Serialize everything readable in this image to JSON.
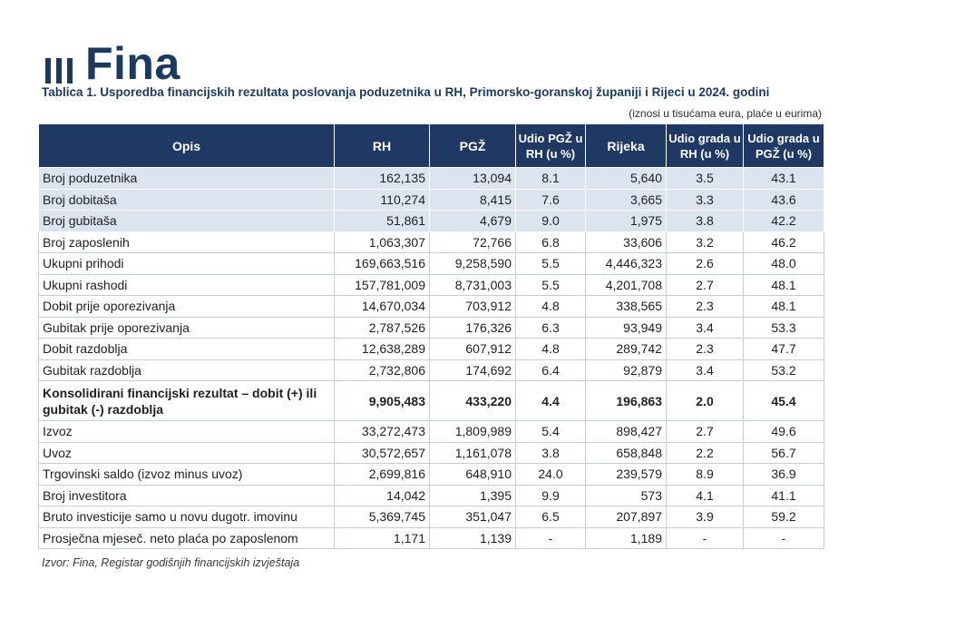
{
  "logo": {
    "text": "Fina"
  },
  "title": "Tablica 1. Usporedba financijskih rezultata poslovanja poduzetnika u RH, Primorsko-goranskoj županiji i Rijeci u 2024. godini",
  "note": "(iznosi u tisućama eura, plaće u eurima)",
  "headers": [
    "Opis",
    "RH",
    "PGŽ",
    "Udio PGŽ u RH (u %)",
    "Rijeka",
    "Udio grada u RH (u %)",
    "Udio grada u PGŽ (u %)"
  ],
  "rows": [
    {
      "opis": "Broj poduzetnika",
      "rh": "162,135",
      "pgz": "13,094",
      "udio_pgz_rh": "8.1",
      "rijeka": "5,640",
      "udio_grada_rh": "3.5",
      "udio_grada_pgz": "43.1",
      "highlight": true
    },
    {
      "opis": "Broj dobitaša",
      "rh": "110,274",
      "pgz": "8,415",
      "udio_pgz_rh": "7.6",
      "rijeka": "3,665",
      "udio_grada_rh": "3.3",
      "udio_grada_pgz": "43.6",
      "highlight": true
    },
    {
      "opis": "Broj gubitaša",
      "rh": "51,861",
      "pgz": "4,679",
      "udio_pgz_rh": "9.0",
      "rijeka": "1,975",
      "udio_grada_rh": "3.8",
      "udio_grada_pgz": "42.2",
      "highlight": true
    },
    {
      "opis": "Broj zaposlenih",
      "rh": "1,063,307",
      "pgz": "72,766",
      "udio_pgz_rh": "6.8",
      "rijeka": "33,606",
      "udio_grada_rh": "3.2",
      "udio_grada_pgz": "46.2"
    },
    {
      "opis": "Ukupni prihodi",
      "rh": "169,663,516",
      "pgz": "9,258,590",
      "udio_pgz_rh": "5.5",
      "rijeka": "4,446,323",
      "udio_grada_rh": "2.6",
      "udio_grada_pgz": "48.0"
    },
    {
      "opis": "Ukupni rashodi",
      "rh": "157,781,009",
      "pgz": "8,731,003",
      "udio_pgz_rh": "5.5",
      "rijeka": "4,201,708",
      "udio_grada_rh": "2.7",
      "udio_grada_pgz": "48.1"
    },
    {
      "opis": "Dobit prije oporezivanja",
      "rh": "14,670,034",
      "pgz": "703,912",
      "udio_pgz_rh": "4.8",
      "rijeka": "338,565",
      "udio_grada_rh": "2.3",
      "udio_grada_pgz": "48.1"
    },
    {
      "opis": "Gubitak prije oporezivanja",
      "rh": "2,787,526",
      "pgz": "176,326",
      "udio_pgz_rh": "6.3",
      "rijeka": "93,949",
      "udio_grada_rh": "3.4",
      "udio_grada_pgz": "53.3"
    },
    {
      "opis": "Dobit razdoblja",
      "rh": "12,638,289",
      "pgz": "607,912",
      "udio_pgz_rh": "4.8",
      "rijeka": "289,742",
      "udio_grada_rh": "2.3",
      "udio_grada_pgz": "47.7"
    },
    {
      "opis": "Gubitak razdoblja",
      "rh": "2,732,806",
      "pgz": "174,692",
      "udio_pgz_rh": "6.4",
      "rijeka": "92,879",
      "udio_grada_rh": "3.4",
      "udio_grada_pgz": "53.2"
    },
    {
      "opis": "Konsolidirani financijski rezultat – dobit (+) ili gubitak (-) razdoblja",
      "rh": "9,905,483",
      "pgz": "433,220",
      "udio_pgz_rh": "4.4",
      "rijeka": "196,863",
      "udio_grada_rh": "2.0",
      "udio_grada_pgz": "45.4",
      "bold": true
    },
    {
      "opis": "Izvoz",
      "rh": "33,272,473",
      "pgz": "1,809,989",
      "udio_pgz_rh": "5.4",
      "rijeka": "898,427",
      "udio_grada_rh": "2.7",
      "udio_grada_pgz": "49.6"
    },
    {
      "opis": "Uvoz",
      "rh": "30,572,657",
      "pgz": "1,161,078",
      "udio_pgz_rh": "3.8",
      "rijeka": "658,848",
      "udio_grada_rh": "2.2",
      "udio_grada_pgz": "56.7"
    },
    {
      "opis": "Trgovinski saldo (izvoz minus uvoz)",
      "rh": "2,699,816",
      "pgz": "648,910",
      "udio_pgz_rh": "24.0",
      "rijeka": "239,579",
      "udio_grada_rh": "8.9",
      "udio_grada_pgz": "36.9"
    },
    {
      "opis": "Broj investitora",
      "rh": "14,042",
      "pgz": "1,395",
      "udio_pgz_rh": "9.9",
      "rijeka": "573",
      "udio_grada_rh": "4.1",
      "udio_grada_pgz": "41.1"
    },
    {
      "opis": "Bruto investicije samo u novu dugotr. imovinu",
      "rh": "5,369,745",
      "pgz": "351,047",
      "udio_pgz_rh": "6.5",
      "rijeka": "207,897",
      "udio_grada_rh": "3.9",
      "udio_grada_pgz": "59.2"
    },
    {
      "opis": "Prosječna mjeseč. neto plaća po zaposlenom",
      "rh": "1,171",
      "pgz": "1,139",
      "udio_pgz_rh": "-",
      "rijeka": "1,189",
      "udio_grada_rh": "-",
      "udio_grada_pgz": "-"
    }
  ],
  "source": "Izvor: Fina, Registar godišnjih financijskih izvještaja",
  "colors": {
    "header_bg": "#203864",
    "highlight_row": "#dce4f0",
    "brand": "#1c3a5e"
  }
}
